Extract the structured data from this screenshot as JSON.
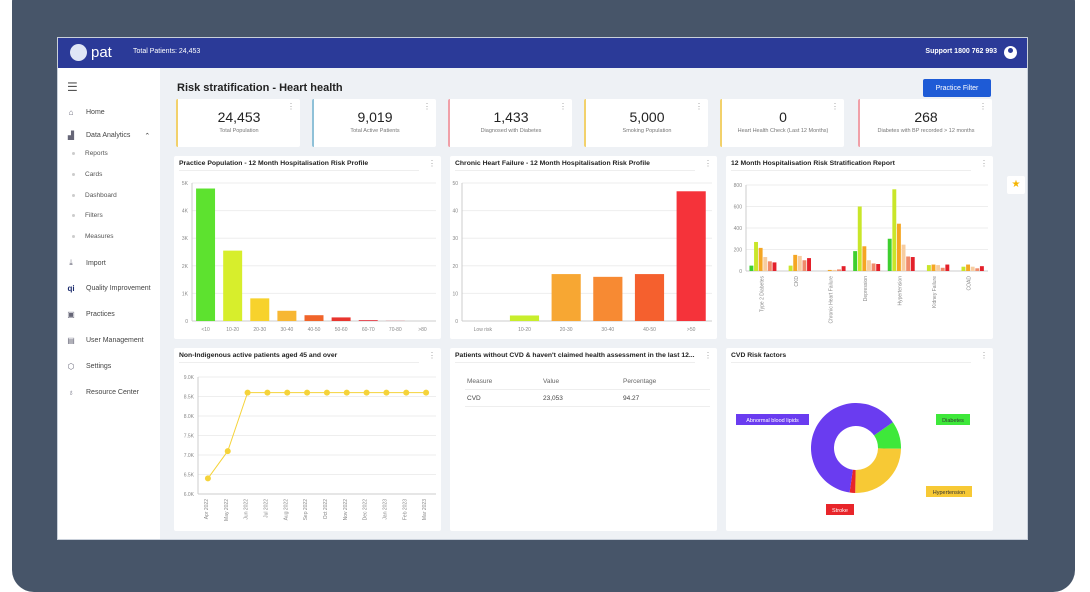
{
  "header": {
    "logo": "pat",
    "total_patients": "Total Patients: 24,453",
    "support": "Support 1800 762 993"
  },
  "sidebar": {
    "items": [
      {
        "label": "Home",
        "icon": "home-icon"
      },
      {
        "label": "Data Analytics",
        "icon": "analytics-icon"
      },
      {
        "label": "Import",
        "icon": "import-icon"
      },
      {
        "label": "Quality Improvement",
        "icon": "qi-icon"
      },
      {
        "label": "Practices",
        "icon": "practices-icon"
      },
      {
        "label": "User Management",
        "icon": "user-management-icon"
      },
      {
        "label": "Settings",
        "icon": "settings-icon"
      },
      {
        "label": "Resource Center",
        "icon": "resource-icon"
      }
    ],
    "sub_items": [
      "Reports",
      "Cards",
      "Dashboard",
      "Filters",
      "Measures"
    ]
  },
  "page": {
    "title": "Risk stratification - Heart health",
    "filter_button": "Practice Filter"
  },
  "kpis": [
    {
      "value": "24,453",
      "label": "Total Population",
      "color": "#f2d16b"
    },
    {
      "value": "9,019",
      "label": "Total Active Patients",
      "color": "#8fc1d8"
    },
    {
      "value": "1,433",
      "label": "Diagnosed with Diabetes",
      "color": "#f0a0a8"
    },
    {
      "value": "5,000",
      "label": "Smoking Population",
      "color": "#f2d16b"
    },
    {
      "value": "0",
      "label": "Heart Health Check (Last 12 Months)",
      "color": "#f2d16b"
    },
    {
      "value": "268",
      "label": "Diabetes with BP recorded > 12 months",
      "color": "#f0a0a8"
    }
  ],
  "table": {
    "title": "Patients without CVD & haven't claimed health assessment in the last 12...",
    "headers": [
      "Measure",
      "Value",
      "Percentage"
    ],
    "rows": [
      [
        "CVD",
        "23,053",
        "94.27"
      ]
    ]
  },
  "chart_data": [
    {
      "type": "bar",
      "title": "Practice Population - 12 Month Hospitalisation Risk Profile",
      "categories": [
        "<10",
        "10-20",
        "20-30",
        "30-40",
        "40-50",
        "50-60",
        "60-70",
        "70-80",
        ">80"
      ],
      "values": [
        4800,
        2550,
        820,
        370,
        210,
        130,
        30,
        5,
        0
      ],
      "colors": [
        "#5de22f",
        "#d7ee2c",
        "#f7d22c",
        "#f7b733",
        "#f0642a",
        "#e8352e",
        "#e0303a",
        "#e0303a",
        "#e0303a"
      ],
      "ylim": [
        0,
        5000
      ],
      "ticks": [
        0,
        1000,
        2000,
        3000,
        4000,
        5000
      ],
      "tick_labels": [
        "0",
        "1K",
        "2K",
        "3K",
        "4K",
        "5K"
      ],
      "grid": true
    },
    {
      "type": "bar",
      "title": "Chronic Heart Failure - 12 Month Hospitalisation Risk Profile",
      "categories": [
        "Low risk",
        "10-20",
        "20-30",
        "30-40",
        "40-50",
        ">50"
      ],
      "values": [
        0,
        2,
        17,
        16,
        17,
        47
      ],
      "colors": [
        "#5de22f",
        "#c8ee2c",
        "#f7a733",
        "#f78a33",
        "#f5602e",
        "#f5333a"
      ],
      "ylim": [
        0,
        50
      ],
      "ticks": [
        0,
        10,
        20,
        30,
        40,
        50
      ],
      "tick_labels": [
        "0",
        "10",
        "20",
        "30",
        "40",
        "50"
      ],
      "grid": true
    },
    {
      "type": "bar",
      "title": "12 Month Hospitalisation Risk Stratification Report",
      "categories": [
        "Type 2 Diabetes",
        "CKD",
        "Chronic Heart Failure",
        "Depression",
        "Hypertension",
        "Kidney Failure",
        "COAD"
      ],
      "series": [
        {
          "values": [
            50,
            270,
            215,
            130,
            90,
            80
          ],
          "label": "group"
        }
      ],
      "grouped_values": [
        [
          50,
          270,
          215,
          130,
          90,
          80
        ],
        [
          0,
          50,
          150,
          140,
          100,
          120
        ],
        [
          0,
          0,
          10,
          10,
          15,
          45
        ],
        [
          185,
          600,
          230,
          100,
          70,
          65
        ],
        [
          300,
          760,
          440,
          245,
          135,
          130
        ],
        [
          0,
          55,
          60,
          55,
          30,
          60
        ],
        [
          0,
          40,
          60,
          40,
          25,
          45
        ]
      ],
      "colors": [
        "#3ecf2f",
        "#c9e62a",
        "#f5a623",
        "#f7cda0",
        "#f08a6a",
        "#e3202a"
      ],
      "ylim": [
        0,
        800
      ],
      "ticks": [
        0,
        200,
        400,
        600,
        800
      ],
      "tick_labels": [
        "0",
        "200",
        "400",
        "600",
        "800"
      ],
      "grid": true
    },
    {
      "type": "line",
      "title": "Non-Indigenous active patients aged 45 and over",
      "categories": [
        "Apr 2022",
        "May 2022",
        "Jun 2022",
        "Jul 2022",
        "Aug 2022",
        "Sep 2022",
        "Oct 2022",
        "Nov 2022",
        "Dec 2022",
        "Jan 2023",
        "Feb 2023",
        "Mar 2023"
      ],
      "values": [
        6400,
        7100,
        8600,
        8600,
        8600,
        8600,
        8600,
        8600,
        8600,
        8600,
        8600,
        8600
      ],
      "color": "#f5d33a",
      "ylim": [
        6000,
        9000
      ],
      "ticks": [
        6000,
        6500,
        7000,
        7500,
        8000,
        8500,
        9000
      ],
      "tick_labels": [
        "6.0K",
        "6.5K",
        "7.0K",
        "7.5K",
        "8.0K",
        "8.5K",
        "9.0K"
      ],
      "grid": true
    },
    {
      "type": "pie",
      "title": "CVD Risk factors",
      "donut": true,
      "slices": [
        {
          "label": "Diabetes",
          "value": 10,
          "color": "#3ee83a"
        },
        {
          "label": "Hypertension",
          "value": 25,
          "color": "#f7c935"
        },
        {
          "label": "Stroke",
          "value": 2,
          "color": "#e8252a"
        },
        {
          "label": "Abnormal blood lipids",
          "value": 63,
          "color": "#6a3cf0"
        }
      ]
    }
  ]
}
